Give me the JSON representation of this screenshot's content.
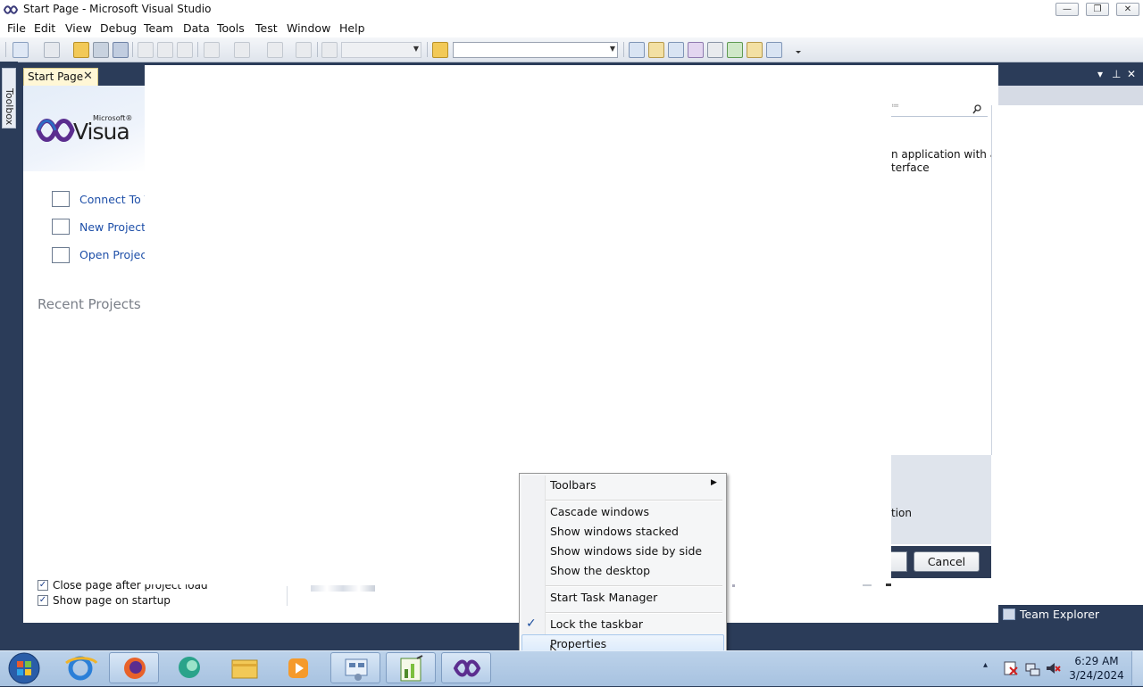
{
  "window": {
    "title": "Start Page - Microsoft Visual Studio",
    "controls": {
      "minimize": "—",
      "restore": "❐",
      "close": "✕"
    }
  },
  "menubar": [
    "File",
    "Edit",
    "View",
    "Debug",
    "Team",
    "Data",
    "Tools",
    "Test",
    "Window",
    "Help"
  ],
  "toolbox": {
    "label": "Toolbox"
  },
  "document_tab": {
    "label": "Start Page",
    "close": "✕"
  },
  "start_page": {
    "logo_top": "Microsoft®",
    "logo_text": "Visua",
    "links": [
      {
        "label": "Connect To Te",
        "icon": "connect-team-icon"
      },
      {
        "label": "New Project...",
        "icon": "new-project-icon"
      },
      {
        "label": "Open Project...",
        "icon": "open-project-icon"
      }
    ],
    "recent_projects": "Recent Projects",
    "options": [
      {
        "label": "Close page after project load",
        "checked": true
      },
      {
        "label": "Show page on startup",
        "checked": true
      }
    ]
  },
  "dialog": {
    "search_hint": "≔",
    "desc_line1": "n application with a",
    "desc_line2": "terface",
    "strip_text": "tion",
    "cancel_label": "Cancel"
  },
  "right_panel": {
    "pin": "⊥",
    "close": "✕",
    "dropdown": "▾"
  },
  "team_explorer": {
    "label": "Team Explorer"
  },
  "context_menu": {
    "items": [
      {
        "label": "Toolbars",
        "submenu": true
      },
      {
        "label": "Cascade windows"
      },
      {
        "label": "Show windows stacked"
      },
      {
        "label": "Show windows side by side"
      },
      {
        "label": "Show the desktop"
      },
      {
        "label": "Start Task Manager"
      },
      {
        "label": "Lock the taskbar",
        "checked": true
      },
      {
        "label": "Properties",
        "highlighted": true
      }
    ]
  },
  "taskbar": {
    "apps": [
      "start-orb",
      "internet-explorer-icon",
      "firefox-icon",
      "edge-chromium-icon",
      "file-explorer-icon",
      "media-player-icon",
      "control-panel-icon",
      "chart-app-icon",
      "visual-studio-icon"
    ],
    "clock_time": "6:29 AM",
    "clock_date": "3/24/2024",
    "tray_expand": "▴"
  },
  "colors": {
    "accent": "#1e4fa8",
    "chrome": "#2b3c59",
    "tab_active": "#fff7d6",
    "menu_highlight": "#dcebfb"
  }
}
